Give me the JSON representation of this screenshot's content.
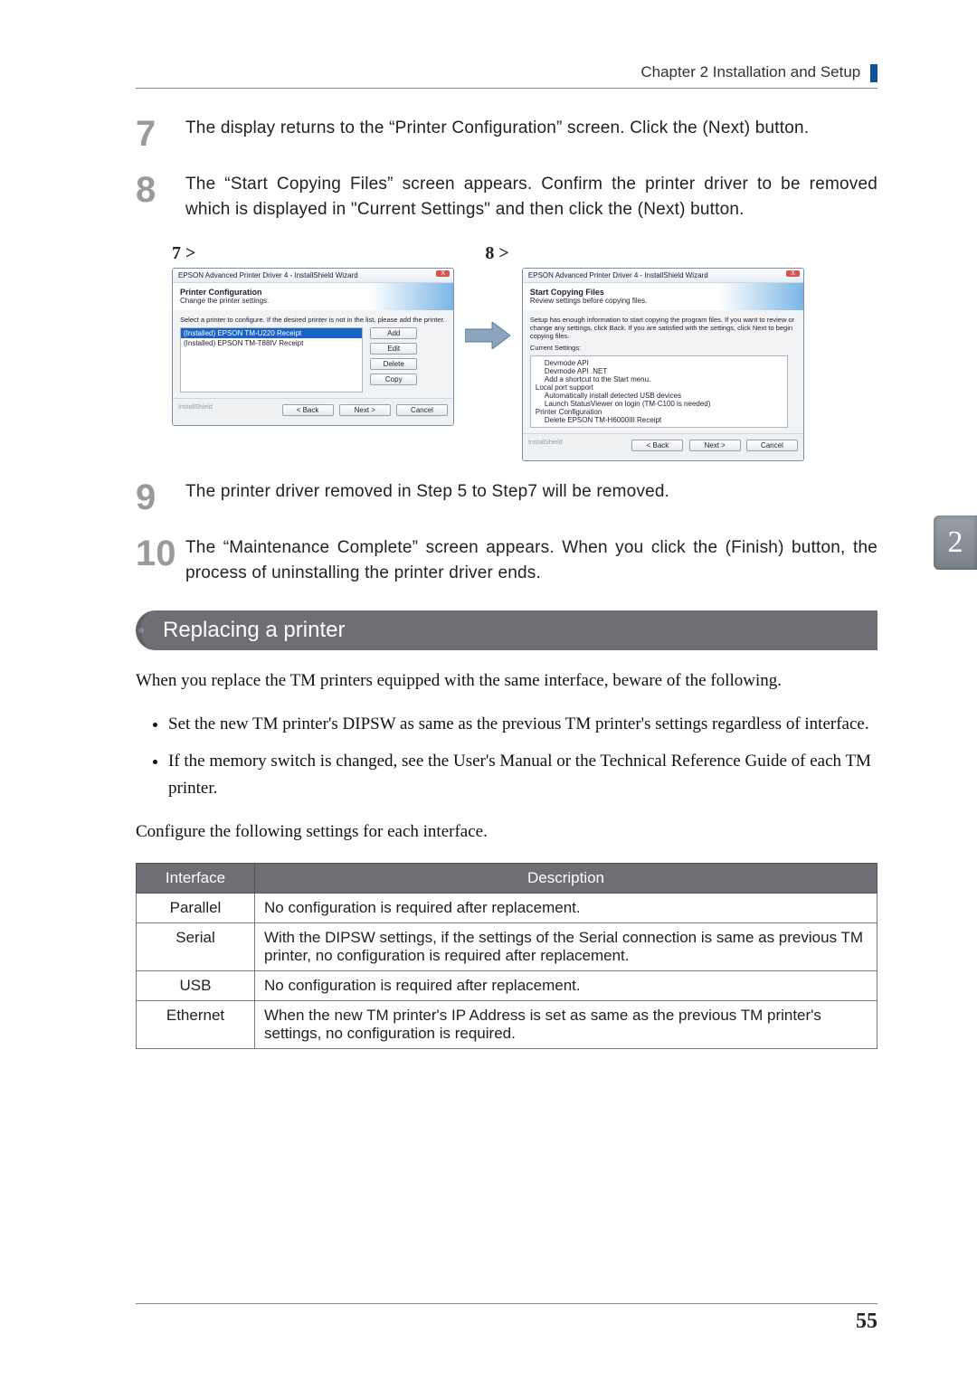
{
  "header": {
    "chapter": "Chapter 2   Installation and Setup"
  },
  "steps": {
    "s7": {
      "num": "7",
      "text": "The display returns to the “Printer Configuration” screen. Click the (Next) button."
    },
    "s8": {
      "num": "8",
      "text": "The “Start Copying Files” screen appears. Confirm the printer driver to be removed which is displayed in \"Current Settings\" and then click the (Next) button."
    },
    "s9": {
      "num": "9",
      "text": "The printer driver removed in Step 5 to Step7 will be removed."
    },
    "s10": {
      "num": "10",
      "text": "The “Maintenance Complete” screen appears. When you click the (Finish) button, the process of uninstalling the printer driver ends."
    },
    "label7": "7 >",
    "label8": "8 >"
  },
  "dialog_left": {
    "title": "EPSON Advanced Printer Driver 4 - InstallShield Wizard",
    "close": "X",
    "head_bold": "Printer Configuration",
    "head_sub": "Change the printer settings.",
    "desc": "Select a printer to configure. If the desired printer is not in the list, please add the printer.",
    "item_selected": "(Installed) EPSON TM-U220 Receipt",
    "item2": "(Installed) EPSON TM-T88IV Receipt",
    "btn_add": "Add",
    "btn_edit": "Edit",
    "btn_delete": "Delete",
    "btn_copy": "Copy",
    "brand": "InstallShield",
    "btn_back": "< Back",
    "btn_next": "Next >",
    "btn_cancel": "Cancel"
  },
  "dialog_right": {
    "title": "EPSON Advanced Printer Driver 4 - InstallShield Wizard",
    "close": "X",
    "head_bold": "Start Copying Files",
    "head_sub": "Review settings before copying files.",
    "desc": "Setup has enough information to start copying the program files. If you want to review or change any settings, click Back. If you are satisfied with the settings, click Next to begin copying files.",
    "current_label": "Current Settings:",
    "lines": {
      "l1": "Devmode API",
      "l2": "Devmode API .NET",
      "l3": "Add a shortcut to the Start menu.",
      "l4": "Local port support",
      "l5": "Automatically install detected USB devices",
      "l6": "Launch StatusViewer on login (TM-C100 is needed)",
      "l7": "Printer Configuration",
      "l8": "Delete EPSON TM-H6000III Receipt"
    },
    "brand": "InstallShield",
    "btn_back": "< Back",
    "btn_next": "Next >",
    "btn_cancel": "Cancel"
  },
  "section": {
    "title": "Replacing a printer",
    "intro": "When you replace the TM printers equipped with the same interface, beware of the following.",
    "bullet1": "Set the new TM printer's DIPSW as same as the previous TM printer's settings regardless of interface.",
    "bullet2": "If the memory switch is changed, see the User's Manual or the Technical Reference Guide of each TM printer.",
    "config_line": "Configure the following settings for each interface."
  },
  "table": {
    "h1": "Interface",
    "h2": "Description",
    "rows": {
      "parallel": {
        "k": "Parallel",
        "v": "No configuration is required after replacement."
      },
      "serial": {
        "k": "Serial",
        "v": "With the DIPSW settings, if the settings of the Serial connection is same as previous TM printer, no configuration is required after replacement."
      },
      "usb": {
        "k": "USB",
        "v": "No configuration is required after replacement."
      },
      "ethernet": {
        "k": "Ethernet",
        "v": "When the new TM printer's IP Address is set as same as the previous TM printer's settings, no configuration is required."
      }
    }
  },
  "page_number": "55",
  "side_tab": "2"
}
